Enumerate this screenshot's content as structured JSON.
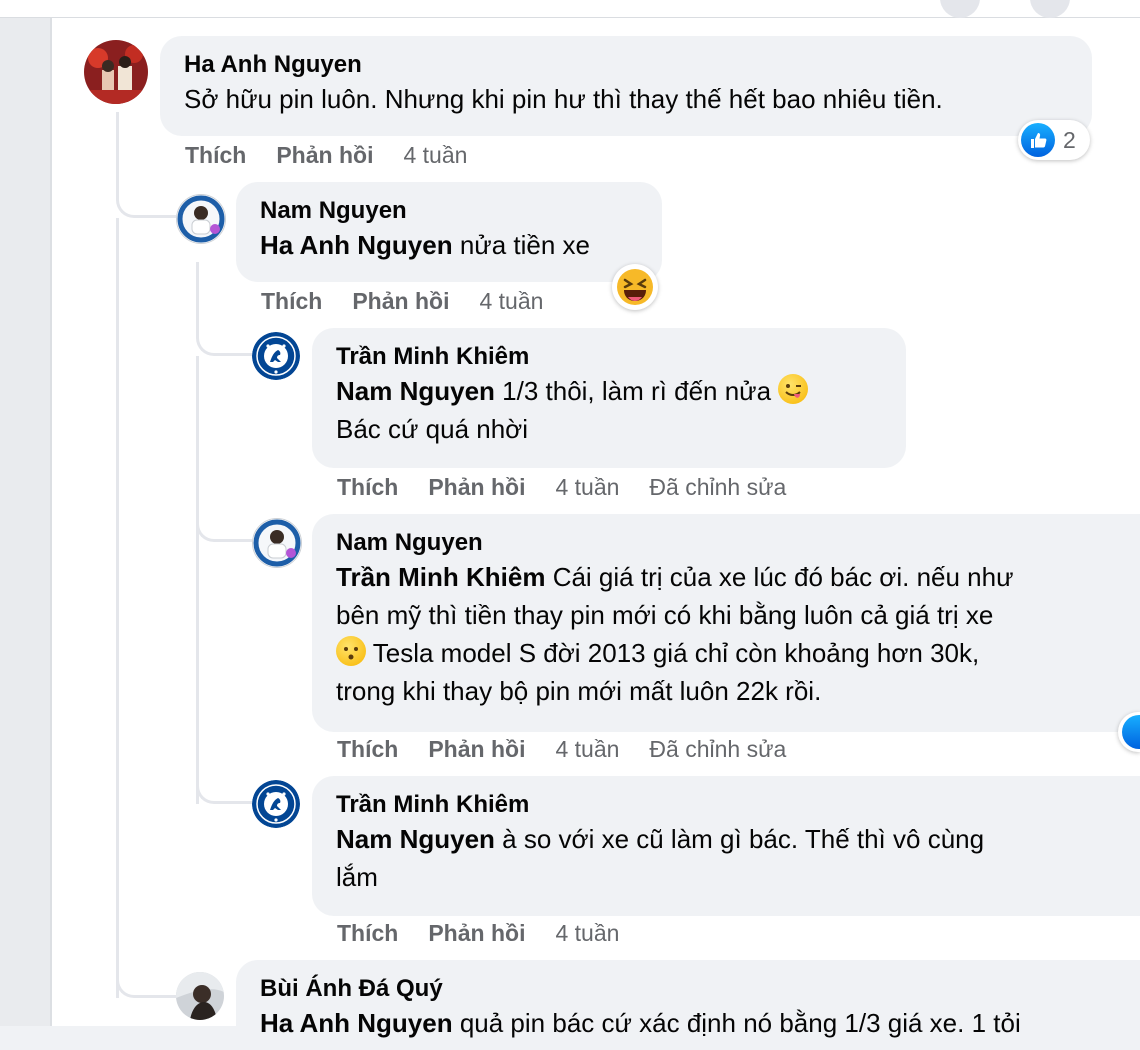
{
  "comments": [
    {
      "author": "Ha Anh Nguyen",
      "text": "Sở hữu pin luôn. Nhưng khi pin hư thì thay thế hết bao nhiêu tiền.",
      "reaction_count": "2",
      "actions": {
        "like": "Thích",
        "reply": "Phản hồi",
        "time": "4 tuần"
      }
    },
    {
      "author": "Nam Nguyen",
      "mention": "Ha Anh Nguyen",
      "text": " nửa tiền xe",
      "reaction_emoji": "laughing-emoji",
      "actions": {
        "like": "Thích",
        "reply": "Phản hồi",
        "time": "4 tuần"
      }
    },
    {
      "author": "Trần Minh Khiêm",
      "mention": "Nam Nguyen",
      "line1": " 1/3 thôi, làm rì đến nửa ",
      "line2": "Bác cứ quá nhời",
      "emoji": "winking-tongue-emoji",
      "actions": {
        "like": "Thích",
        "reply": "Phản hồi",
        "time": "4 tuần",
        "edited": "Đã chỉnh sửa"
      }
    },
    {
      "author": "Nam Nguyen",
      "mention": "Trần Minh Khiêm",
      "line1": " Cái giá trị của xe lúc đó bác ơi. nếu như",
      "line2": "bên mỹ thì tiền thay pin mới có khi bằng luôn cả giá trị xe",
      "line3": " Tesla model S đời 2013 giá chỉ còn khoảng hơn 30k,",
      "line4": "trong khi thay bộ pin mới mất luôn 22k rồi.",
      "emoji": "hushed-emoji",
      "actions": {
        "like": "Thích",
        "reply": "Phản hồi",
        "time": "4 tuần",
        "edited": "Đã chỉnh sửa"
      }
    },
    {
      "author": "Trần Minh Khiêm",
      "mention": "Nam Nguyen",
      "line1": " à so với xe cũ làm gì bác. Thế thì vô cùng",
      "line2": "lắm",
      "actions": {
        "like": "Thích",
        "reply": "Phản hồi",
        "time": "4 tuần"
      }
    },
    {
      "author": "Bùi Ánh Đá Quý",
      "mention": "Ha Anh Nguyen",
      "text": " quả pin bác cứ xác định nó bằng 1/3 giá xe. 1 tỏi"
    }
  ],
  "colors": {
    "background": "#f0f2f5",
    "bubble": "#f0f2f5",
    "meta_text": "#65676b",
    "like_blue": "#0866ff",
    "chelsea_blue": "#034694"
  }
}
